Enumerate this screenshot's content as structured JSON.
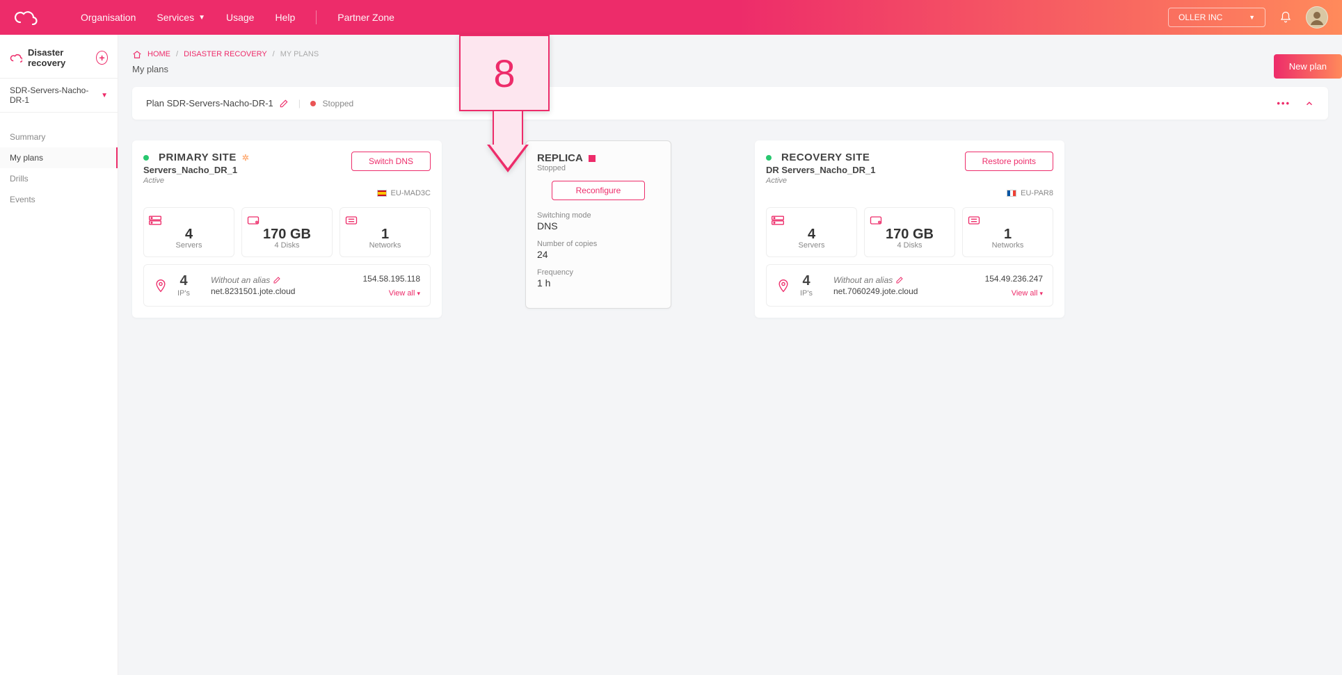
{
  "topnav": {
    "items": [
      "Organisation",
      "Services",
      "Usage",
      "Help"
    ],
    "partner": "Partner Zone",
    "org": "OLLER INC"
  },
  "sidebar": {
    "title": "Disaster recovery",
    "plan_select": "SDR-Servers-Nacho-DR-1",
    "nav": [
      "Summary",
      "My plans",
      "Drills",
      "Events"
    ],
    "active_index": 1
  },
  "breadcrumb": {
    "home": "HOME",
    "section": "DISASTER RECOVERY",
    "current": "MY PLANS"
  },
  "page": {
    "subtitle": "My plans",
    "new_plan": "New plan"
  },
  "planbar": {
    "name": "Plan SDR-Servers-Nacho-DR-1",
    "status": "Stopped"
  },
  "callout": {
    "number": "8"
  },
  "primary": {
    "title": "PRIMARY SITE",
    "name": "Servers_Nacho_DR_1",
    "state": "Active",
    "action": "Switch DNS",
    "region": "EU-MAD3C",
    "stats": {
      "servers": {
        "value": "4",
        "label": "Servers"
      },
      "storage": {
        "value": "170 GB",
        "label": "4 Disks"
      },
      "networks": {
        "value": "1",
        "label": "Networks"
      }
    },
    "ips": {
      "count": "4",
      "count_label": "IP's",
      "alias": "Without an alias",
      "domain": "net.8231501.jote.cloud",
      "ip": "154.58.195.118",
      "viewall": "View all"
    }
  },
  "replica": {
    "title": "REPLICA",
    "state": "Stopped",
    "action": "Reconfigure",
    "switching_mode_label": "Switching mode",
    "switching_mode": "DNS",
    "copies_label": "Number of copies",
    "copies": "24",
    "freq_label": "Frequency",
    "freq": "1 h"
  },
  "recovery": {
    "title": "RECOVERY SITE",
    "name": "DR Servers_Nacho_DR_1",
    "state": "Active",
    "action": "Restore points",
    "region": "EU-PAR8",
    "stats": {
      "servers": {
        "value": "4",
        "label": "Servers"
      },
      "storage": {
        "value": "170 GB",
        "label": "4 Disks"
      },
      "networks": {
        "value": "1",
        "label": "Networks"
      }
    },
    "ips": {
      "count": "4",
      "count_label": "IP's",
      "alias": "Without an alias",
      "domain": "net.7060249.jote.cloud",
      "ip": "154.49.236.247",
      "viewall": "View all"
    }
  }
}
